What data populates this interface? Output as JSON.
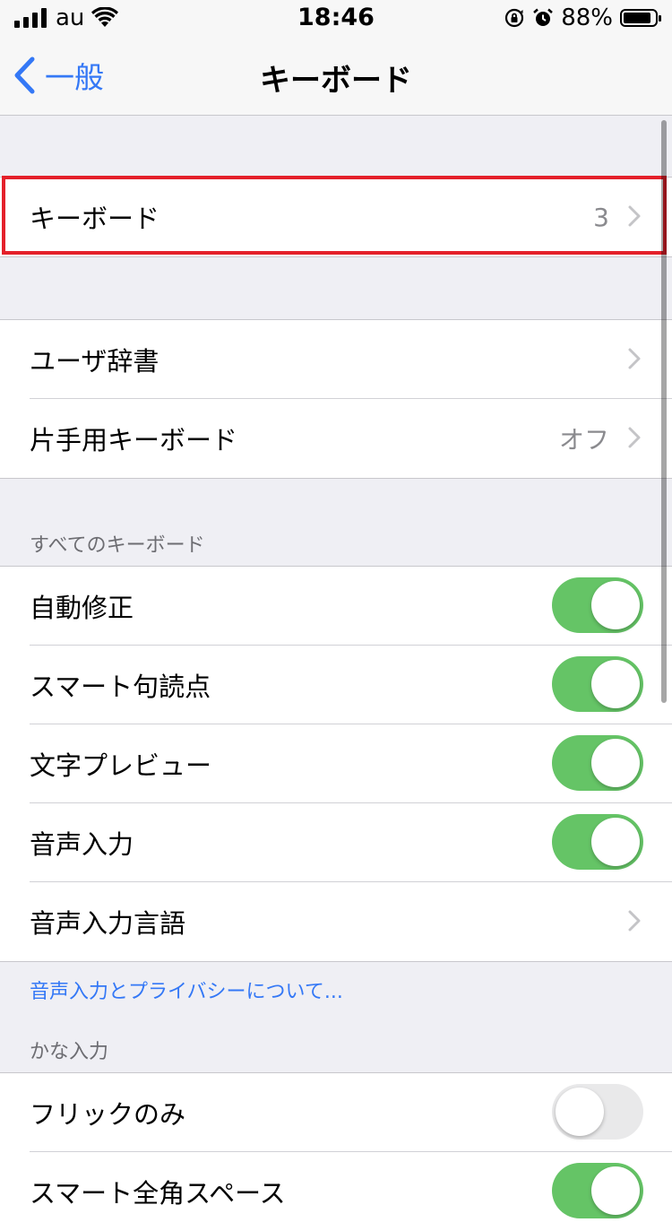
{
  "status_bar": {
    "carrier": "au",
    "time": "18:46",
    "battery_percent": "88%",
    "battery_level": 0.88
  },
  "nav": {
    "back_label": "一般",
    "title": "キーボード"
  },
  "group1": {
    "keyboards_label": "キーボード",
    "keyboards_value": "3"
  },
  "group2": {
    "user_dictionary": "ユーザ辞書",
    "one_handed_keyboard": "片手用キーボード",
    "one_handed_value": "オフ"
  },
  "all_keyboards": {
    "header": "すべてのキーボード",
    "auto_correction": "自動修正",
    "smart_punctuation": "スマート句読点",
    "character_preview": "文字プレビュー",
    "dictation": "音声入力",
    "dictation_languages": "音声入力言語",
    "privacy_link": "音声入力とプライバシーについて..."
  },
  "kana": {
    "header": "かな入力",
    "flick_only": "フリックのみ",
    "smart_fullwidth_space": "スマート全角スペース"
  },
  "colors": {
    "accent": "#3478f6",
    "toggle_on": "#65c466",
    "highlight": "#e4202a"
  }
}
